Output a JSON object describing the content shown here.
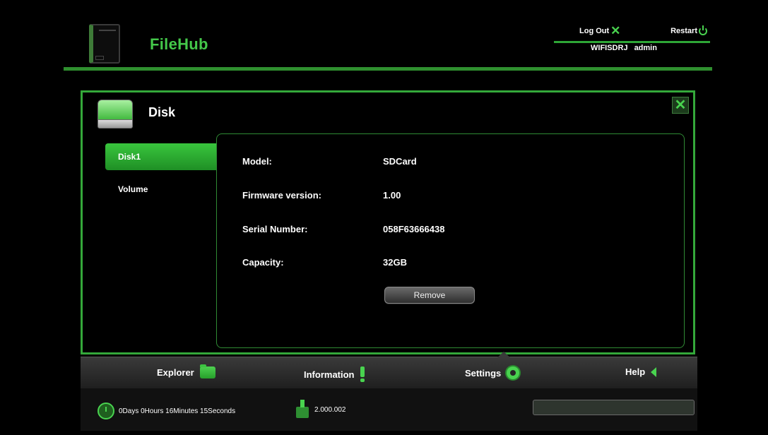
{
  "header": {
    "brand": "FileHub",
    "logout_label": "Log Out",
    "restart_label": "Restart",
    "device_name": "WIFISDRJ",
    "username": "admin"
  },
  "panel": {
    "title": "Disk",
    "tabs": [
      {
        "label": "Disk1",
        "active": true
      },
      {
        "label": "Volume",
        "active": false
      }
    ],
    "details": [
      {
        "label": "Model:",
        "value": "SDCard"
      },
      {
        "label": "Firmware version:",
        "value": "1.00"
      },
      {
        "label": "Serial Number:",
        "value": "058F63666438"
      },
      {
        "label": "Capacity:",
        "value": "32GB"
      }
    ],
    "remove_label": "Remove"
  },
  "nav": {
    "explorer": "Explorer",
    "information": "Information",
    "settings": "Settings",
    "help": "Help",
    "active": "settings"
  },
  "status": {
    "uptime": "0Days 0Hours 16Minutes 15Seconds",
    "version": "2.000.002",
    "progress_percent": 0
  },
  "icons": {
    "close": "close-icon",
    "logout": "x-icon",
    "restart": "power-icon",
    "disk": "disk-icon",
    "explorer": "folder-icon",
    "information": "exclamation-icon",
    "settings": "gear-icon",
    "help": "triangle-left-icon",
    "uptime": "clock-icon",
    "version": "package-icon"
  },
  "colors": {
    "accent": "#34a83a",
    "brand": "#44c84a",
    "background": "#000000"
  }
}
